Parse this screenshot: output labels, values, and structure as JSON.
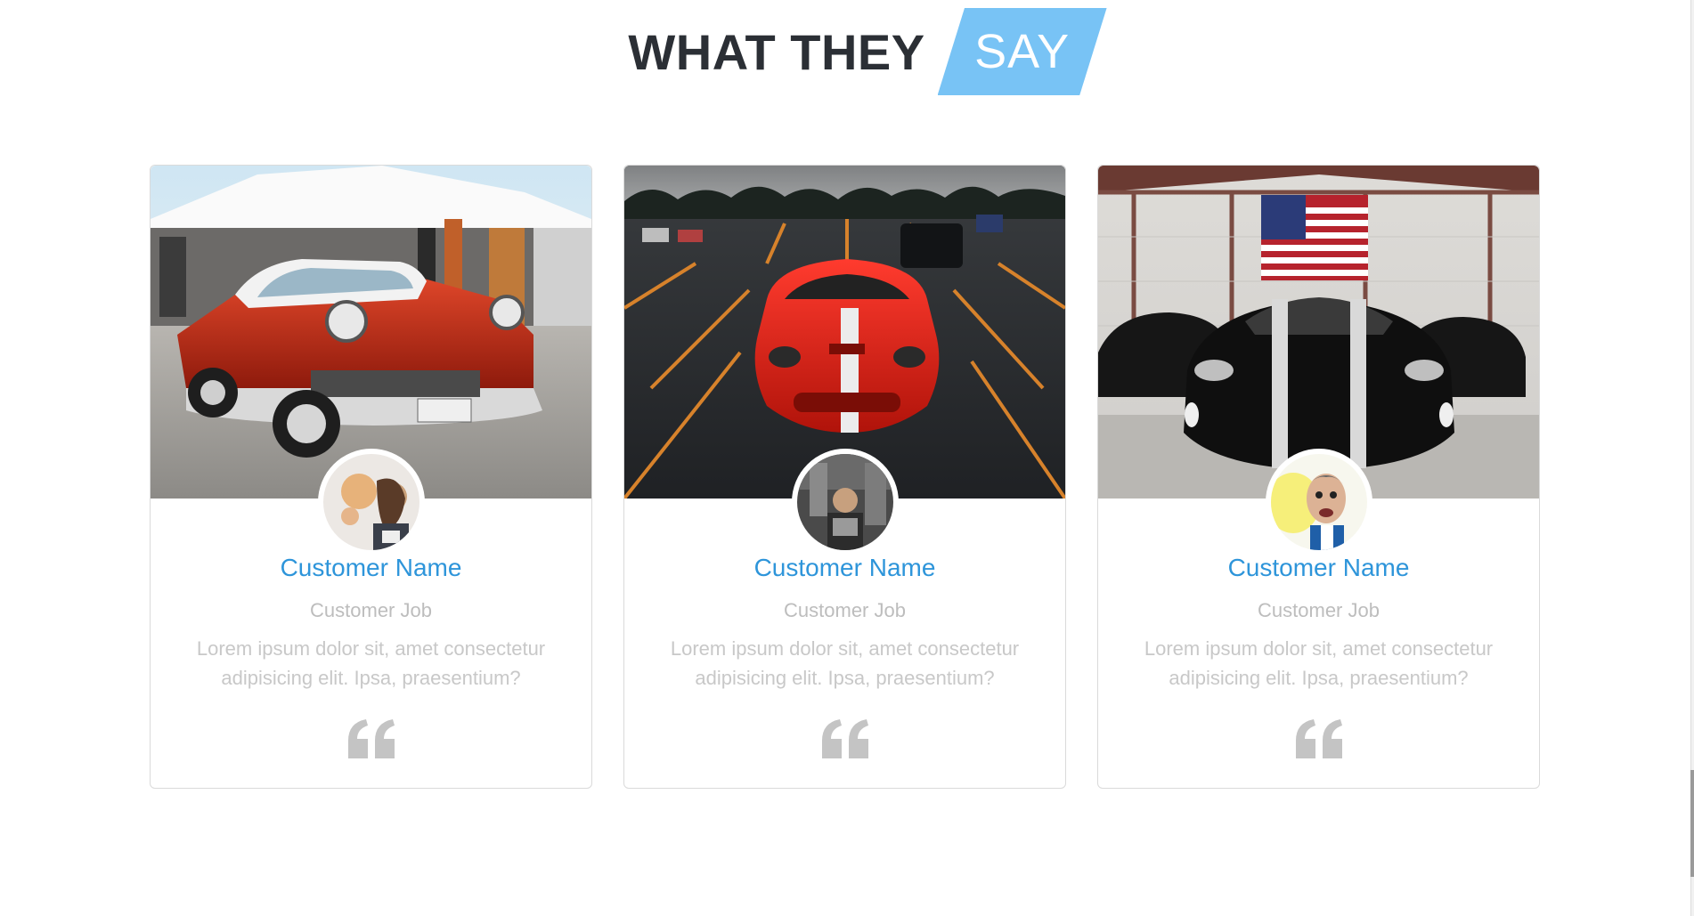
{
  "heading": {
    "main": "WHAT THEY",
    "accent": "SAY"
  },
  "colors": {
    "accent": "#78c3f5",
    "name": "#2e95da",
    "heading": "#2b2f35",
    "muted": "#bdbdbd"
  },
  "testimonials": [
    {
      "photo_icon": "classic-red-car-photo",
      "avatar_icon": "customer-avatar",
      "name": "Customer Name",
      "job": "Customer Job",
      "text": "Lorem ipsum dolor sit, amet consectetur adipisicing elit. Ipsa, praesentium?",
      "quote_icon": "quote-icon"
    },
    {
      "photo_icon": "red-sports-car-photo",
      "avatar_icon": "customer-avatar",
      "name": "Customer Name",
      "job": "Customer Job",
      "text": "Lorem ipsum dolor sit, amet consectetur adipisicing elit. Ipsa, praesentium?",
      "quote_icon": "quote-icon"
    },
    {
      "photo_icon": "black-sports-car-photo",
      "avatar_icon": "customer-avatar",
      "name": "Customer Name",
      "job": "Customer Job",
      "text": "Lorem ipsum dolor sit, amet consectetur adipisicing elit. Ipsa, praesentium?",
      "quote_icon": "quote-icon"
    }
  ]
}
